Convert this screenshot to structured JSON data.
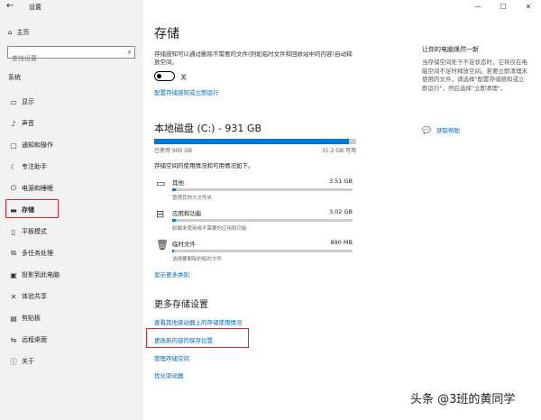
{
  "window": {
    "title": "设置",
    "back_icon": "back-arrow-icon",
    "controls": [
      "—",
      "☐",
      "✕"
    ]
  },
  "sidebar": {
    "home": "主页",
    "search_placeholder": "查找设置",
    "section": "系统",
    "items": [
      {
        "label": "显示",
        "icon": "display-icon"
      },
      {
        "label": "声音",
        "icon": "sound-icon"
      },
      {
        "label": "通知和操作",
        "icon": "notification-icon"
      },
      {
        "label": "专注助手",
        "icon": "moon-icon"
      },
      {
        "label": "电源和睡眠",
        "icon": "power-icon"
      },
      {
        "label": "存储",
        "icon": "storage-icon",
        "selected": true
      },
      {
        "label": "平板模式",
        "icon": "tablet-icon"
      },
      {
        "label": "多任务处理",
        "icon": "multitask-icon"
      },
      {
        "label": "投影到此电脑",
        "icon": "project-icon"
      },
      {
        "label": "体验共享",
        "icon": "share-icon"
      },
      {
        "label": "剪贴板",
        "icon": "clipboard-icon"
      },
      {
        "label": "远程桌面",
        "icon": "remote-icon"
      },
      {
        "label": "关于",
        "icon": "info-icon"
      }
    ]
  },
  "main": {
    "title": "存储",
    "description": "存储感知可以通过删除不需要的文件(例如临时文件和回收站中的内容)自动释放空间。",
    "toggle_label": "关",
    "configure_link": "配置存储感知或立即运行",
    "disk_title": "本地磁盘 (C:) - 931 GB",
    "used_label": "已使用 900 GB",
    "free_label": "31.2 GB 可用",
    "used_fraction": 0.966,
    "usage_subtitle": "存储空间的使用情况和可用情况如下。",
    "categories": [
      {
        "name": "其他",
        "size": "3.51 GB",
        "desc": "管理其他大文件夹",
        "icon": "folder-icon",
        "fraction": 0.02
      },
      {
        "name": "应用和功能",
        "size": "3.02 GB",
        "desc": "卸载未使用或不需要的应用和功能",
        "icon": "apps-icon",
        "fraction": 0.02
      },
      {
        "name": "临时文件",
        "size": "890 MB",
        "desc": "选择要删除的临时文件",
        "icon": "trash-icon",
        "fraction": 0.01
      }
    ],
    "more_categories_link": "显示更多类别",
    "more_settings_title": "更多存储设置",
    "links": [
      "查看其他驱动器上的存储使用情况",
      "更改新内容的保存位置",
      "管理存储空间",
      "优化驱动器"
    ]
  },
  "right": {
    "title": "让你的电脑焕然一新",
    "description": "当存储空间处于不足状态时，它将仅在电脑空间不足时释放空间。若要立即清理未使用的文件，请选择\"配置存储感知或立即运行\"，然后选择\"立即清理\"。",
    "help_label": "获取帮助"
  },
  "watermark": "头条 @3班的黄同学"
}
